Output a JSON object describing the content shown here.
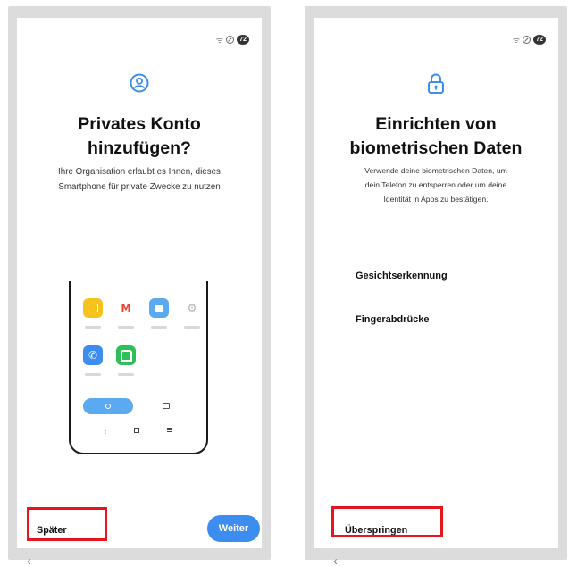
{
  "left_screen": {
    "title_line1": "Privates Konto",
    "title_line2": "hinzufügen?",
    "subtitle_line1": "Ihre Organisation erlaubt es Ihnen, dieses",
    "subtitle_line2": "Smartphone für private Zwecke zu nutzen",
    "later_label": "Später",
    "next_label": "Weiter",
    "status_battery": "72",
    "hero_icon": "account-circle-icon",
    "illustration_apps": [
      "files",
      "gmail",
      "messages",
      "settings",
      "phone",
      "green-app"
    ]
  },
  "right_screen": {
    "title_line1": "Einrichten von",
    "title_line2": "biometrischen Daten",
    "subtitle_line1": "Verwende deine biometrischen Daten, um",
    "subtitle_line2": "dein Telefon zu entsperren oder um deine",
    "subtitle_line3": "Identität in Apps zu bestätigen.",
    "options": [
      {
        "label": "Gesichtserkennung"
      },
      {
        "label": "Fingerabdrücke"
      }
    ],
    "skip_label": "Überspringen",
    "status_battery": "72",
    "hero_icon": "lock-icon"
  },
  "colors": {
    "accent_blue": "#3d8df0",
    "highlight_red": "#e8141e",
    "frame_gray": "#dcdcdc"
  }
}
